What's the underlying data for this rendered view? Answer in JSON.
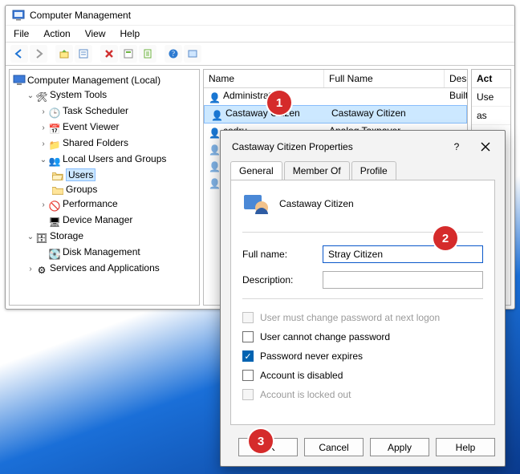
{
  "window": {
    "title": "Computer Management",
    "menu": [
      "File",
      "Action",
      "View",
      "Help"
    ]
  },
  "tree": {
    "root": "Computer Management (Local)",
    "system_tools": "System Tools",
    "task_scheduler": "Task Scheduler",
    "event_viewer": "Event Viewer",
    "shared_folders": "Shared Folders",
    "lug": "Local Users and Groups",
    "users": "Users",
    "groups": "Groups",
    "performance": "Performance",
    "device_manager": "Device Manager",
    "storage": "Storage",
    "disk_mgmt": "Disk Management",
    "services": "Services and Applications"
  },
  "list": {
    "cols": {
      "name": "Name",
      "full": "Full Name",
      "desc": "Description"
    },
    "rows": [
      {
        "name": "Administrator",
        "full": "",
        "desc": "Built-in account f"
      },
      {
        "name": "Castaway Citizen",
        "full": "Castaway Citizen",
        "desc": "",
        "selected": true
      },
      {
        "name": "codru",
        "full": "Analog Taxpayer",
        "desc": ""
      }
    ]
  },
  "actions": {
    "header": "Act",
    "r1": "Use",
    "r2": "as"
  },
  "dialog": {
    "title": "Castaway Citizen Properties",
    "tabs": {
      "general": "General",
      "memberof": "Member Of",
      "profile": "Profile"
    },
    "display_name": "Castaway Citizen",
    "labels": {
      "fullname": "Full name:",
      "description": "Description:"
    },
    "fullname_value": "Stray Citizen",
    "description_value": "",
    "checks": {
      "must_change": "User must change password at next logon",
      "cannot_change": "User cannot change password",
      "never_expires": "Password never expires",
      "disabled": "Account is disabled",
      "locked": "Account is locked out"
    },
    "buttons": {
      "ok": "OK",
      "cancel": "Cancel",
      "apply": "Apply",
      "help": "Help"
    }
  },
  "badges": {
    "b1": "1",
    "b2": "2",
    "b3": "3"
  }
}
